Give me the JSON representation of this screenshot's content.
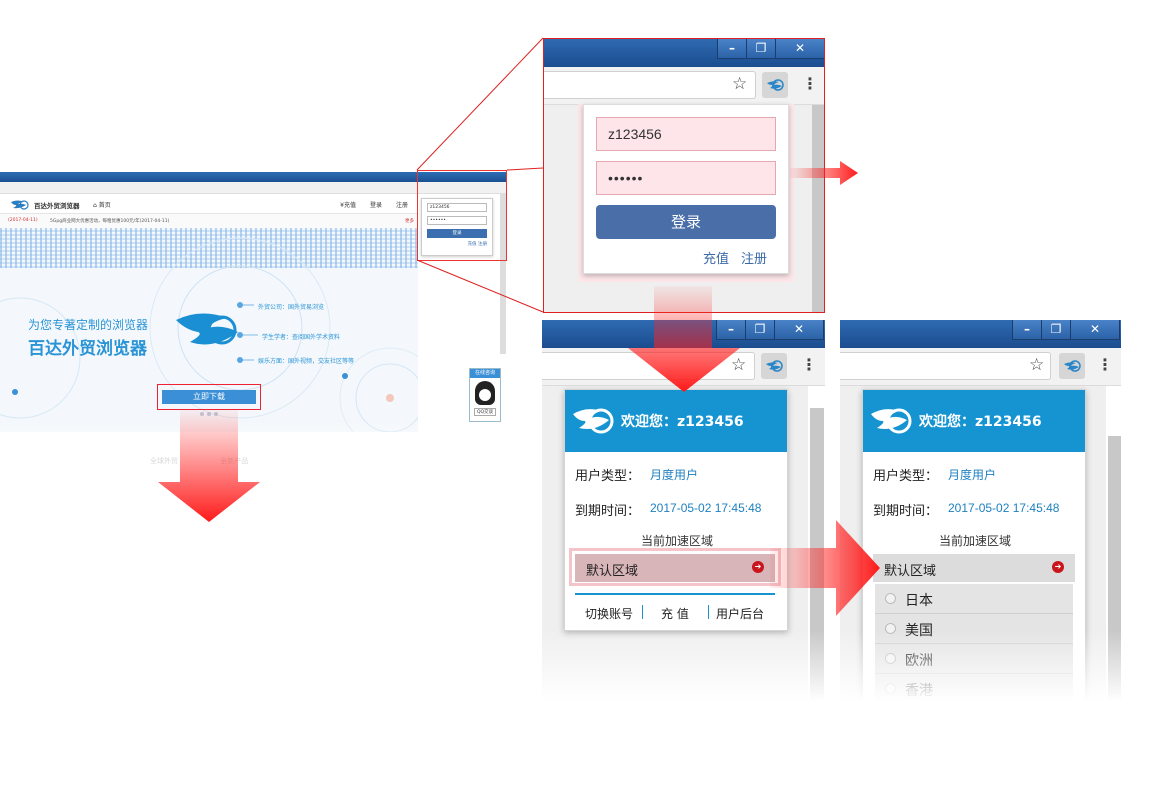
{
  "colors": {
    "accent_blue": "#1694d2",
    "titlebar_blue": "#2a5fa6",
    "login_button": "#4a6ea8",
    "highlight_red": "#e02020",
    "region_highlight": "#d8b5b8"
  },
  "mini_browser": {
    "brand": "百达外贸浏览器",
    "home_link": "首页",
    "nav": [
      "¥充值",
      "登录",
      "注册"
    ],
    "ticker_date": "(2017-04-11)",
    "ticker_text": "5Gpg商业网大优惠活动，每租优惠100元/年(2017-04-11)",
    "ticker_more": "更多",
    "slogan_line1": "为您专著定制的浏览器",
    "slogan_line2": "百达外贸浏览器",
    "features": [
      "外贸公司：国外贸易浏览",
      "学生学者：查阅国外学术资料",
      "娱乐方面：国外视频，交友社区等等"
    ],
    "download_button": "立即下载",
    "online_chat": "在线咨询",
    "qq_chat": "QQ交谈",
    "mini_popup": {
      "username": "z123456",
      "password": "••••••",
      "login": "登录",
      "links": "充值  注册"
    },
    "footer_links": [
      "全球外贸",
      "全新产品"
    ]
  },
  "login_panel": {
    "window_buttons": [
      "–",
      "❐",
      "✕"
    ],
    "username_value": "z123456",
    "password_value": "••••••",
    "login_button": "登录",
    "recharge_link": "充值",
    "register_link": "注册",
    "bookmark_icon": "star-icon",
    "extension_icon": "bird-logo-icon",
    "menu_icon": "more-vertical-icon"
  },
  "welcome_panel": {
    "title": "欢迎您：z123456",
    "user_type_label": "用户类型：",
    "user_type_value": "月度用户",
    "expiry_label": "到期时间：",
    "expiry_value": "2017-05-02 17:45:48",
    "region_caption": "当前加速区域",
    "region_selected": "默认区域",
    "actions": {
      "switch_account": "切换账号",
      "recharge": "充 值",
      "user_backend": "用户后台"
    }
  },
  "region_panel": {
    "title": "欢迎您：z123456",
    "user_type_label": "用户类型：",
    "user_type_value": "月度用户",
    "expiry_label": "到期时间：",
    "expiry_value": "2017-05-02 17:45:48",
    "region_caption": "当前加速区域",
    "region_selected": "默认区域",
    "regions": [
      "日本",
      "美国",
      "欧洲",
      "香港"
    ]
  }
}
